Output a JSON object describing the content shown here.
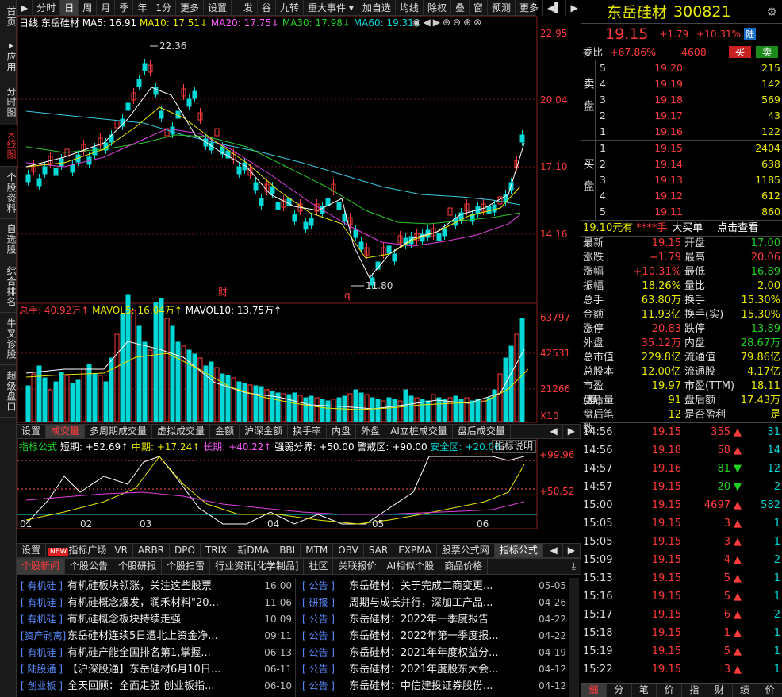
{
  "left_tabs": [
    {
      "label": "首页"
    },
    {
      "label": "应用"
    },
    {
      "label": "分时图"
    },
    {
      "label": "K线图",
      "active": true
    },
    {
      "label": "个股资料"
    },
    {
      "label": "自选股"
    },
    {
      "label": "综合排名"
    },
    {
      "label": "牛叉诊股"
    },
    {
      "label": "超级盘口"
    }
  ],
  "toolbar": {
    "items": [
      "分时",
      "日",
      "周",
      "月",
      "季",
      "年",
      "1分",
      "更多",
      "设置",
      "发",
      "谷",
      "九转",
      "重大事件",
      "加自选",
      "均线",
      "除权",
      "叠",
      "窗",
      "预测",
      "更多"
    ],
    "active": "日"
  },
  "chart": {
    "period": "日线",
    "name": "东岳硅材",
    "ma": {
      "ma5": "MA5: 16.91",
      "ma10": "MA10: 17.51↓",
      "ma20": "MA20: 17.75↓",
      "ma30": "MA30: 17.98↓",
      "ma60": "MA60: 19.31↓"
    },
    "price_axis": [
      "22.95",
      "20.04",
      "17.10",
      "14.16"
    ],
    "high_label": "22.36",
    "low_label": "11.80",
    "marker_cai": "财",
    "marker_q": "q",
    "vol_header": {
      "total": "总手: 40.92万↑",
      "mavol5": "MAVOL5: 16.04万↑",
      "mavol10": "MAVOL10: 13.75万↑"
    },
    "vol_axis": [
      "63797",
      "42531",
      "21266",
      "X10"
    ],
    "ind_tabs": [
      "设置",
      "成交量",
      "多周期成交量",
      "虚拟成交量",
      "金额",
      "沪深金额",
      "换手率",
      "内盘",
      "外盘",
      "AI立桩成交量",
      "盘后成交量"
    ],
    "ind_active": "成交量",
    "ind_header": {
      "name": "指标公式",
      "short": "短期: +52.69↑",
      "mid": "中期: +17.24↑",
      "long": "长期: +40.22↑",
      "strong": "强弱分界: +50.00",
      "alert": "警戒区: +90.00",
      "safe": "安全区: +20.00",
      "help": "指标说明"
    },
    "ind_axis": [
      "+99.96",
      "+50.52"
    ],
    "months": [
      "01",
      "02",
      "03",
      "04",
      "05",
      "06"
    ]
  },
  "chart_data": {
    "type": "candlestick",
    "series": [
      {
        "name": "MA5"
      },
      {
        "name": "MA10"
      },
      {
        "name": "MA20"
      },
      {
        "name": "MA30"
      },
      {
        "name": "MA60"
      }
    ],
    "high": 22.36,
    "low": 11.8,
    "last": 19.15,
    "ylim": [
      14.16,
      22.95
    ],
    "volume_max": 63797
  },
  "bottom_tabs": [
    "设置",
    "NEW",
    "指标广场",
    "VR",
    "ARBR",
    "DPO",
    "TRIX",
    "新DMA",
    "BBI",
    "MTM",
    "OBV",
    "SAR",
    "EXPMA",
    "股票公式网",
    "指标公式"
  ],
  "news_tabs": [
    "个股新闻",
    "个股公告",
    "个股研报",
    "个股扫雷",
    "行业资讯[化学制品]",
    "社区",
    "关联报价",
    "AI相似个股",
    "商品价格"
  ],
  "news_left": [
    {
      "tag": "[ 有机硅 ]",
      "title": "有机硅板块领涨，关注这些股票",
      "time": "16:00"
    },
    {
      "tag": "[ 有机硅 ]",
      "title": "有机硅概念爆发，润禾材料\"20...",
      "time": "11:06"
    },
    {
      "tag": "[ 有机硅 ]",
      "title": "有机硅概念板块持续走强",
      "time": "10:09"
    },
    {
      "tag": "[资产剥离]",
      "title": "东岳硅材连续5日遭北上资金净...",
      "time": "09:11"
    },
    {
      "tag": "[ 有机硅 ]",
      "title": "有机硅产能全国排名第1,掌握...",
      "time": "06-13"
    },
    {
      "tag": "[ 陆股通 ]",
      "title": "【沪深股通】东岳硅材6月10日...",
      "time": "06-11"
    },
    {
      "tag": "[ 创业板 ]",
      "title": "全天回顾：全面走强 创业板指...",
      "time": "06-10"
    }
  ],
  "news_right": [
    {
      "tag": "[ 公告 ]",
      "title": "东岳硅材：关于完成工商变更...",
      "time": "05-05"
    },
    {
      "tag": "[ 研报 ]",
      "title": "周期与成长并行，深加工产品...",
      "time": "04-26"
    },
    {
      "tag": "[ 公告 ]",
      "title": "东岳硅材：2022年一季度报告",
      "time": "04-22"
    },
    {
      "tag": "[ 公告 ]",
      "title": "东岳硅材：2022年第一季度报...",
      "time": "04-22"
    },
    {
      "tag": "[ 公告 ]",
      "title": "东岳硅材：2021年年度权益分...",
      "time": "04-19"
    },
    {
      "tag": "[ 公告 ]",
      "title": "东岳硅材：2021年度股东大会...",
      "time": "04-12"
    },
    {
      "tag": "[ 公告 ]",
      "title": "东岳硅材：中信建投证券股份...",
      "time": "04-12"
    }
  ],
  "quote": {
    "name": "东岳硅材",
    "code": "300821",
    "price": "19.15",
    "change": "+1.79",
    "pct": "+10.31%",
    "board": "陆",
    "weibi_label": "委比",
    "weibi": "+67.86%",
    "weicha": "4608",
    "buy": "买",
    "sell": "卖",
    "sell_side": "卖盘",
    "buy_side": "买盘",
    "asks": [
      {
        "n": "5",
        "p": "19.20",
        "v": "215"
      },
      {
        "n": "4",
        "p": "19.19",
        "v": "142"
      },
      {
        "n": "3",
        "p": "19.18",
        "v": "569"
      },
      {
        "n": "2",
        "p": "19.17",
        "v": "43"
      },
      {
        "n": "1",
        "p": "19.16",
        "v": "122"
      }
    ],
    "bids": [
      {
        "n": "1",
        "p": "19.15",
        "v": "2404"
      },
      {
        "n": "2",
        "p": "19.14",
        "v": "638"
      },
      {
        "n": "3",
        "p": "19.13",
        "v": "1185"
      },
      {
        "n": "4",
        "p": "19.12",
        "v": "612"
      },
      {
        "n": "5",
        "p": "19.11",
        "v": "860"
      }
    ],
    "bigorder": {
      "a": "19.10元有",
      "b": "****手",
      "c": "大买单",
      "d": "点击查看"
    },
    "stats": [
      [
        "最新",
        "19.15",
        "开盘",
        "17.00"
      ],
      [
        "涨跌",
        "+1.79",
        "最高",
        "20.06"
      ],
      [
        "涨幅",
        "+10.31%",
        "最低",
        "16.89"
      ],
      [
        "振幅",
        "18.26%",
        "量比",
        "2.00"
      ],
      [
        "总手",
        "63.80万",
        "换手",
        "15.30%"
      ],
      [
        "金额",
        "11.93亿",
        "换手(实)",
        "15.30%"
      ],
      [
        "涨停",
        "20.83",
        "跌停",
        "13.89"
      ],
      [
        "外盘",
        "35.12万",
        "内盘",
        "28.67万"
      ],
      [
        "总市值",
        "229.8亿",
        "流通值",
        "79.86亿"
      ],
      [
        "总股本",
        "12.00亿",
        "流通股",
        "4.17亿"
      ],
      [
        "市盈(静)",
        "19.97",
        "市盈(TTM)",
        "18.11"
      ],
      [
        "盘后量",
        "91",
        "盘后额",
        "17.43万"
      ],
      [
        "盘后笔数",
        "12",
        "是否盈利",
        "是"
      ]
    ],
    "ticks": [
      {
        "t": "14:56",
        "p": "19.15",
        "v": "355",
        "d": "up",
        "n": "31"
      },
      {
        "t": "14:56",
        "p": "19.18",
        "v": "58",
        "d": "up",
        "n": "14"
      },
      {
        "t": "14:57",
        "p": "19.16",
        "v": "81",
        "d": "down",
        "n": "12"
      },
      {
        "t": "14:57",
        "p": "19.15",
        "v": "20",
        "d": "down",
        "n": "2"
      },
      {
        "t": "15:00",
        "p": "19.15",
        "v": "4697",
        "d": "up",
        "n": "582"
      },
      {
        "t": "15:05",
        "p": "19.15",
        "v": "3",
        "d": "up",
        "n": "1"
      },
      {
        "t": "15:05",
        "p": "19.15",
        "v": "3",
        "d": "up",
        "n": "1"
      },
      {
        "t": "15:09",
        "p": "19.15",
        "v": "4",
        "d": "up",
        "n": "2"
      },
      {
        "t": "15:13",
        "p": "19.15",
        "v": "5",
        "d": "up",
        "n": "1"
      },
      {
        "t": "15:16",
        "p": "19.15",
        "v": "5",
        "d": "up",
        "n": "1"
      },
      {
        "t": "15:17",
        "p": "19.15",
        "v": "6",
        "d": "up",
        "n": "2"
      },
      {
        "t": "15:18",
        "p": "19.15",
        "v": "1",
        "d": "up",
        "n": "1"
      },
      {
        "t": "15:19",
        "p": "19.15",
        "v": "5",
        "d": "up",
        "n": "1"
      },
      {
        "t": "15:22",
        "p": "19.15",
        "v": "3",
        "d": "up",
        "n": "1"
      }
    ],
    "bottom_tabs": [
      "细",
      "分",
      "笔",
      "价",
      "指",
      "财",
      "绩",
      "价"
    ]
  }
}
